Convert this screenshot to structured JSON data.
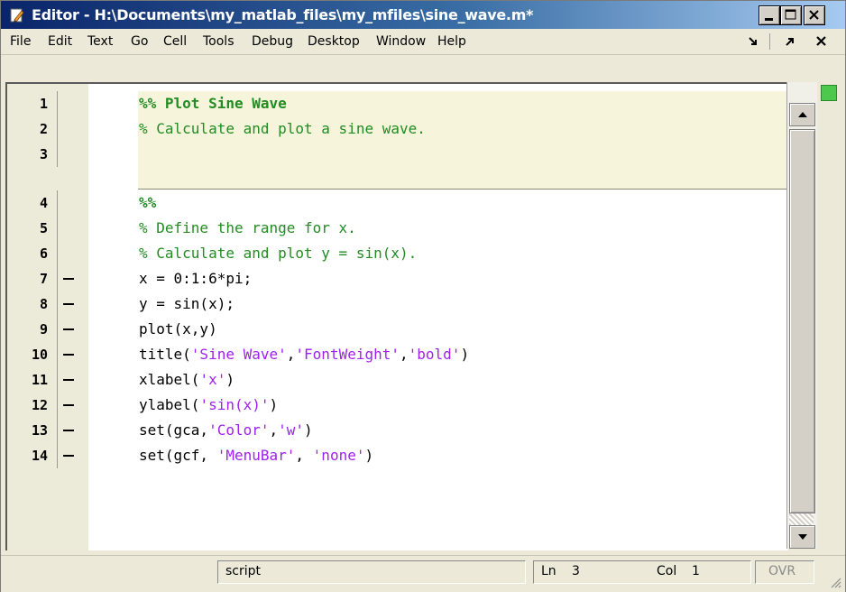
{
  "window": {
    "title": "Editor - H:\\Documents\\my_matlab_files\\my_mfiles\\sine_wave.m*"
  },
  "menu": [
    "File",
    "Edit",
    "Text",
    "Go",
    "Cell",
    "Tools",
    "Debug",
    "Desktop",
    "Window",
    "Help"
  ],
  "editor": {
    "lines": [
      {
        "num": "1",
        "exec": false
      },
      {
        "num": "2",
        "exec": false
      },
      {
        "num": "3",
        "exec": false
      },
      {
        "num": "4",
        "exec": false
      },
      {
        "num": "5",
        "exec": false
      },
      {
        "num": "6",
        "exec": false
      },
      {
        "num": "7",
        "exec": true
      },
      {
        "num": "8",
        "exec": true
      },
      {
        "num": "9",
        "exec": true
      },
      {
        "num": "10",
        "exec": true
      },
      {
        "num": "11",
        "exec": true
      },
      {
        "num": "12",
        "exec": true
      },
      {
        "num": "13",
        "exec": true
      },
      {
        "num": "14",
        "exec": true
      }
    ],
    "code": {
      "l1": "%% Plot Sine Wave",
      "l2": "% Calculate and plot a sine wave.",
      "l3": "",
      "l4": "%%",
      "l5": "% Define the range for x.",
      "l6": "% Calculate and plot y = sin(x).",
      "l7": "x = 0:1:6*pi;",
      "l8": "y = sin(x);",
      "l9": "plot(x,y)",
      "l10": {
        "a": "title(",
        "s1": "'Sine Wave'",
        "b": ",",
        "s2": "'FontWeight'",
        "c": ",",
        "s3": "'bold'",
        "d": ")"
      },
      "l11": {
        "a": "xlabel(",
        "s1": "'x'",
        "d": ")"
      },
      "l12": {
        "a": "ylabel(",
        "s1": "'sin(x)'",
        "d": ")"
      },
      "l13": {
        "a": "set(gca,",
        "s1": "'Color'",
        "b": ",",
        "s2": "'w'",
        "d": ")"
      },
      "l14": {
        "a": "set(gcf, ",
        "s1": "'MenuBar'",
        "b": ", ",
        "s2": "'none'",
        "d": ")"
      }
    }
  },
  "status": {
    "mode": "script",
    "ln_label": "Ln",
    "ln_value": "3",
    "col_label": "Col",
    "col_value": "1",
    "ovr": "OVR"
  },
  "colors": {
    "comment": "#228b22",
    "string": "#a020f0",
    "cell_highlight": "#f6f5dc",
    "title_bar": "#0a246a"
  }
}
